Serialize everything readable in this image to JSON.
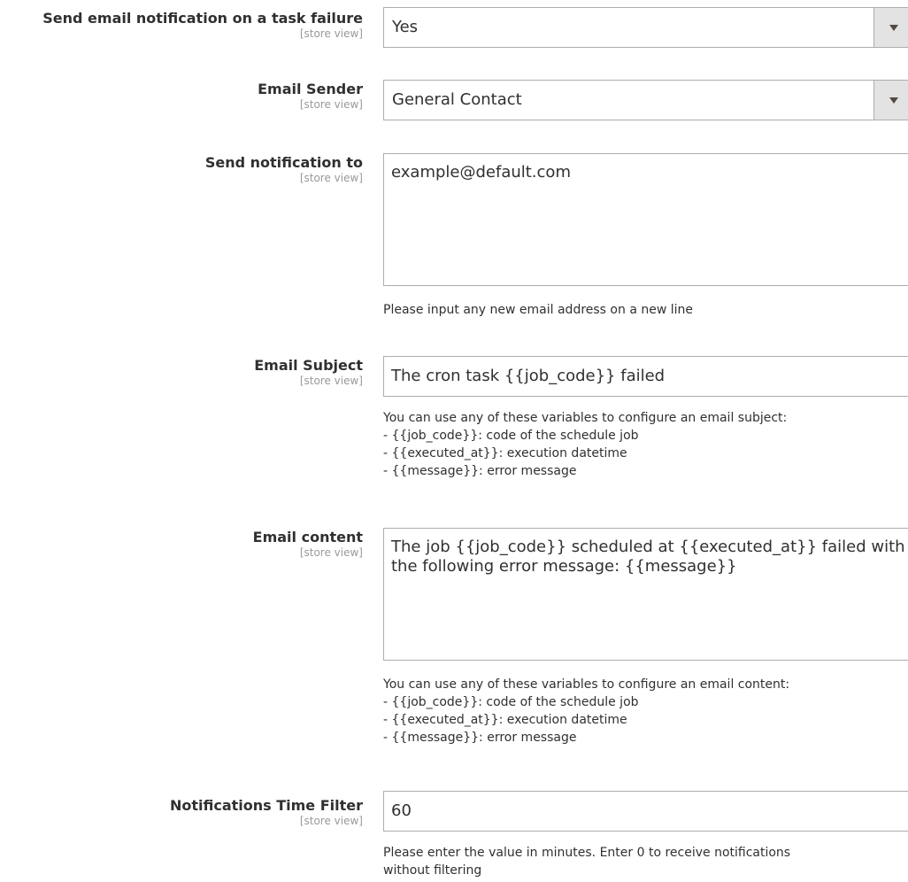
{
  "fields": {
    "failure_notify": {
      "label": "Send email notification on a task failure",
      "scope": "[store view]",
      "value": "Yes"
    },
    "email_sender": {
      "label": "Email Sender",
      "scope": "[store view]",
      "value": "General Contact"
    },
    "send_to": {
      "label": "Send notification to",
      "scope": "[store view]",
      "value": "example@default.com",
      "note": "Please input any new email address on a new line"
    },
    "email_subject": {
      "label": "Email Subject",
      "scope": "[store view]",
      "value": "The cron task {{job_code}} failed",
      "note": [
        "You can use any of these variables to configure an email subject:",
        "- {{job_code}}: code of the schedule job",
        "- {{executed_at}}: execution datetime",
        "- {{message}}: error message"
      ]
    },
    "email_content": {
      "label": "Email content",
      "scope": "[store view]",
      "value": "The job {{job_code}} scheduled at {{executed_at}} failed with the following error message: {{message}}",
      "note": [
        "You can use any of these variables to configure an email content:",
        "- {{job_code}}: code of the schedule job",
        "- {{executed_at}}: execution datetime",
        "- {{message}}: error message"
      ]
    },
    "time_filter": {
      "label": "Notifications Time Filter",
      "scope": "[store view]",
      "value": "60",
      "note": [
        "Please enter the value in minutes. Enter 0 to receive notifications",
        "without filtering"
      ]
    }
  },
  "icons": {
    "dropdown": "chevron-down-icon"
  }
}
